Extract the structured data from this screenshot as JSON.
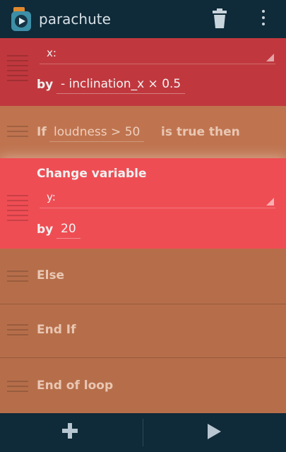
{
  "app": {
    "title": "parachute"
  },
  "bricks": {
    "set_x": {
      "variable": "x:",
      "by_label": "by",
      "by_value": "- inclination_x × 0.5"
    },
    "if": {
      "if_label": "If",
      "condition": "loudness > 50",
      "then_label": "is true then"
    },
    "change_variable": {
      "title": "Change variable",
      "variable": "y:",
      "by_label": "by",
      "by_value": "20"
    },
    "else": {
      "label": "Else"
    },
    "end_if": {
      "label": "End If"
    },
    "end_loop": {
      "label": "End of loop"
    }
  },
  "icons": {
    "app": "pocket-code-icon",
    "trash": "trash-icon",
    "menu": "overflow-menu-icon",
    "add": "plus-icon",
    "play": "play-icon"
  },
  "colors": {
    "appbar": "#0f2a38",
    "brick_brown": "#b66e4a",
    "brick_red": "#c0383e",
    "brick_active": "#ef4d54"
  }
}
